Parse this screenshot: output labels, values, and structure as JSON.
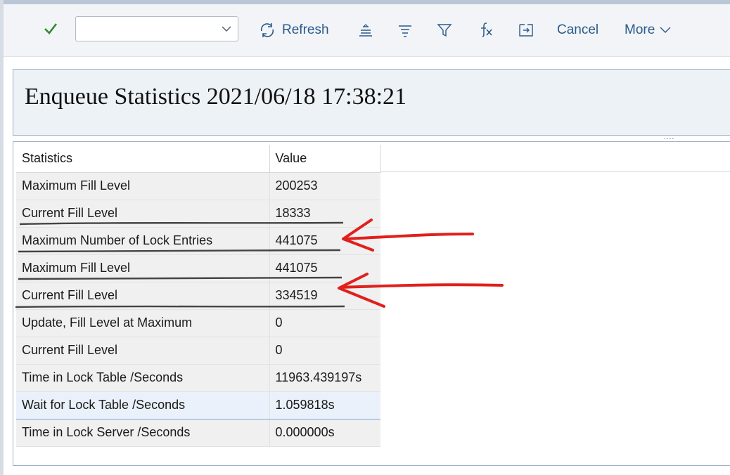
{
  "toolbar": {
    "confirm_icon": "check-icon",
    "combo_value": "",
    "refresh_label": "Refresh",
    "cancel_label": "Cancel",
    "more_label": "More",
    "icons": [
      "check-icon",
      "chevron-down-icon",
      "refresh-icon",
      "align-top-icon",
      "align-center-icon",
      "filter-icon",
      "clear-formula-icon",
      "export-icon"
    ]
  },
  "header": {
    "title": "Enqueue Statistics 2021/06/18 17:38:21"
  },
  "table": {
    "columns": [
      "Statistics",
      "Value"
    ],
    "rows": [
      {
        "name": "Maximum Fill Level",
        "value": "200253"
      },
      {
        "name": "Current Fill Level",
        "value": "18333"
      },
      {
        "name": "Maximum Number of Lock Entries",
        "value": "441075"
      },
      {
        "name": "Maximum Fill Level",
        "value": "441075"
      },
      {
        "name": "Current Fill Level",
        "value": "334519"
      },
      {
        "name": "Update, Fill Level at Maximum",
        "value": "0"
      },
      {
        "name": "Current Fill Level",
        "value": "0"
      },
      {
        "name": "Time in Lock Table /Seconds",
        "value": "11963.439197s"
      },
      {
        "name": "Wait for Lock Table /Seconds",
        "value": "1.059818s"
      },
      {
        "name": "Time in Lock Server /Seconds",
        "value": "0.000000s"
      }
    ],
    "selected_row": 8
  },
  "colors": {
    "accent": "#2a5a8a",
    "check": "#2e8b2e",
    "annotation": "#e0201b"
  }
}
